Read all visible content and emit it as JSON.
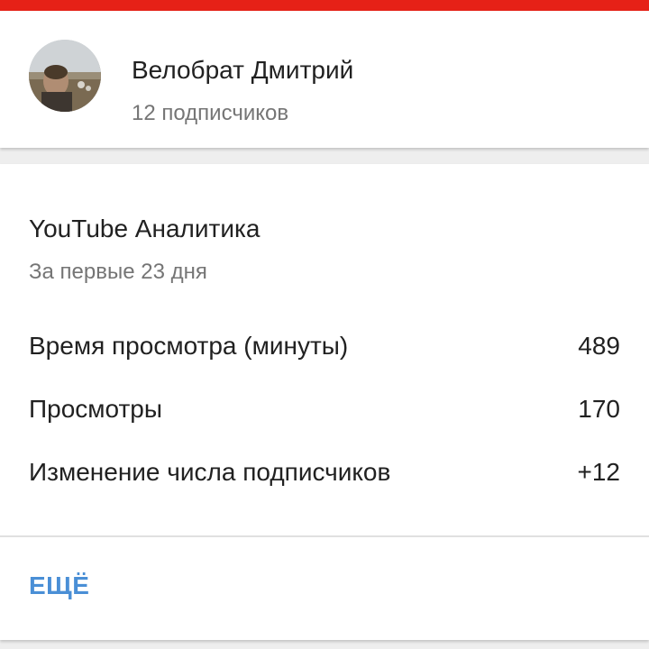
{
  "header": {
    "accent_color": "#e62117"
  },
  "channel": {
    "name": "Велобрат Дмитрий",
    "subscribers": "12 подписчиков",
    "avatar_icon": "channel-avatar-photo"
  },
  "analytics": {
    "title": "YouTube Аналитика",
    "period": "За первые 23 дня",
    "metrics": [
      {
        "label": "Время просмотра (минуты)",
        "value": "489"
      },
      {
        "label": "Просмотры",
        "value": "170"
      },
      {
        "label": "Изменение числа подписчиков",
        "value": "+12"
      }
    ],
    "more_label": "ЕЩЁ",
    "more_color": "#4a8fd6"
  }
}
